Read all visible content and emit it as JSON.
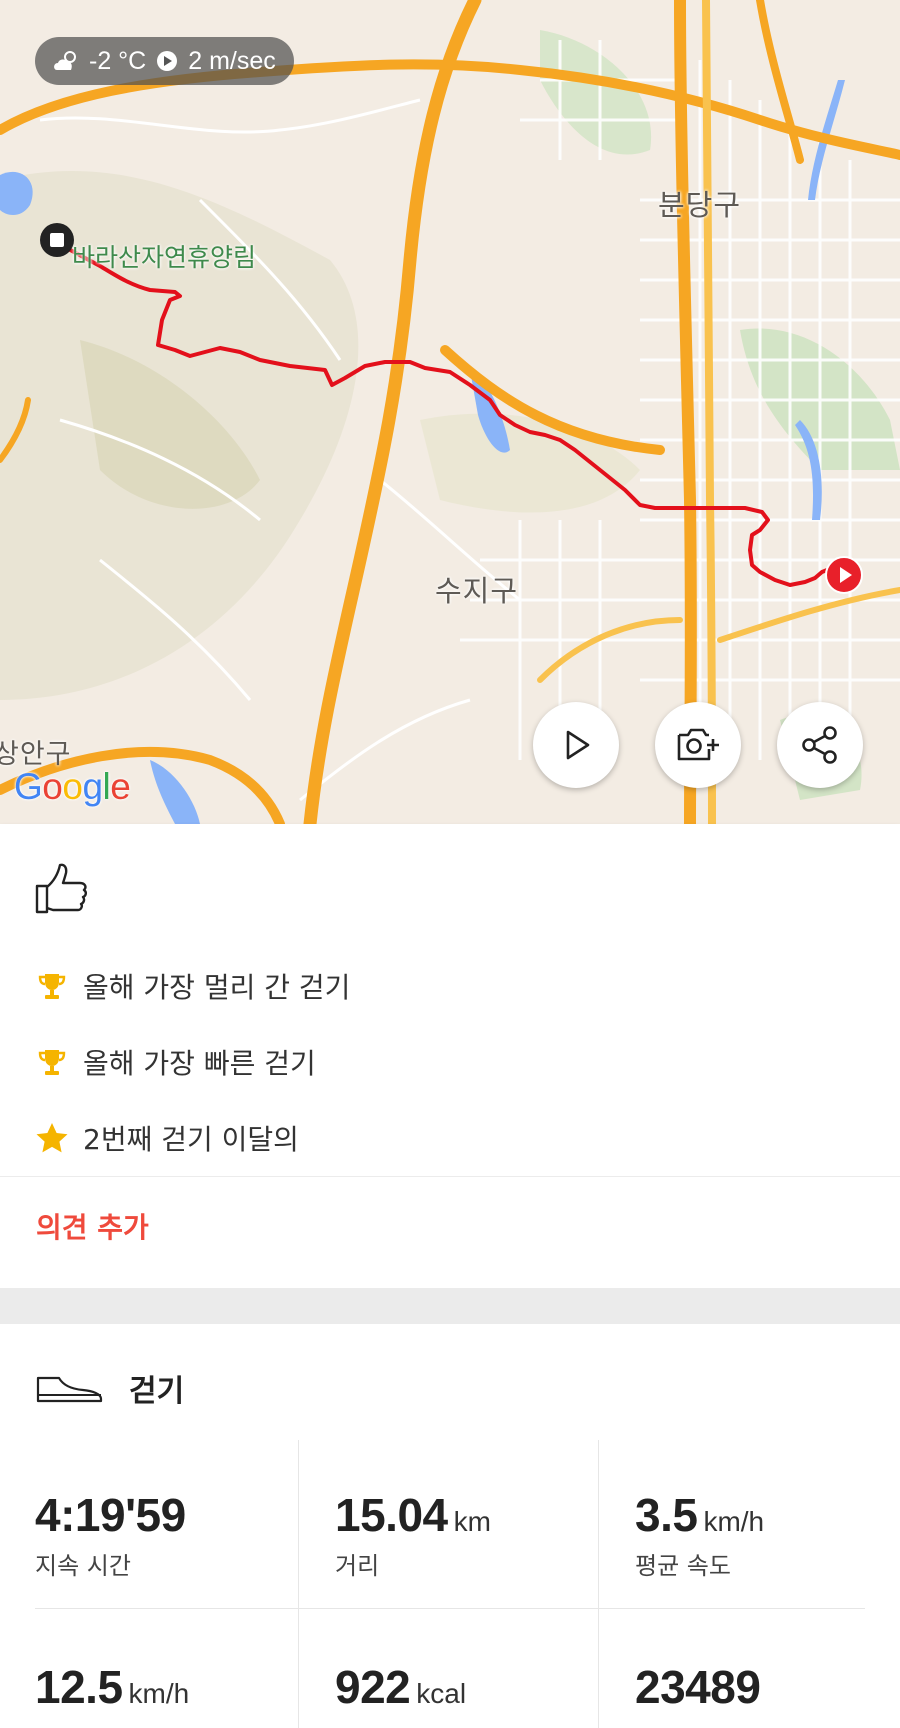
{
  "weather": {
    "temperature": "-2 °C",
    "wind": "2 m/sec",
    "weather_icon": "cloud-sun-icon",
    "wind_icon": "wind-direction-icon"
  },
  "map": {
    "labels": {
      "bundang": "분당구",
      "suji": "수지구",
      "forest": "바라산자연휴양림",
      "partial_left": "상안구"
    },
    "logo_text": "Google",
    "route_color": "#e3101b",
    "end_marker_color": "#e8202a",
    "start_marker_color": "#222222"
  },
  "map_actions": {
    "play_icon": "play-icon",
    "camera_icon": "camera-add-icon",
    "share_icon": "share-icon"
  },
  "feedback": {
    "like_icon": "thumbs-up-icon",
    "achievements": [
      {
        "icon": "trophy-icon",
        "text": "올해 가장 멀리 간 걷기"
      },
      {
        "icon": "trophy-icon",
        "text": "올해 가장 빠른 걷기"
      },
      {
        "icon": "star-icon",
        "text": "2번째 걷기 이달의"
      }
    ],
    "add_comment": "의견 추가",
    "accent_color": "#ef4a3c"
  },
  "activity": {
    "icon": "shoe-icon",
    "type": "걷기"
  },
  "stats": [
    {
      "value": "4:19'59",
      "unit": "",
      "label": "지속 시간"
    },
    {
      "value": "15.04",
      "unit": "km",
      "label": "거리"
    },
    {
      "value": "3.5",
      "unit": "km/h",
      "label": "평균 속도"
    },
    {
      "value": "12.5",
      "unit": "km/h",
      "label": ""
    },
    {
      "value": "922",
      "unit": "kcal",
      "label": ""
    },
    {
      "value": "23489",
      "unit": "",
      "label": ""
    }
  ]
}
